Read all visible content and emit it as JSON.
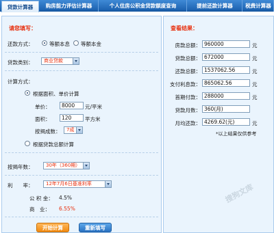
{
  "tabs": [
    "贷款计算器",
    "购房能力评估计算器",
    "个人住房公积金贷款额度查询",
    "提前还款计算器",
    "税费计算器"
  ],
  "form": {
    "title": "请您填写：",
    "repay_method_label": "还款方式：",
    "repay_options": [
      "等额本息",
      "等额本金"
    ],
    "repay_selected": "等额本息",
    "loan_type_label": "贷款类别：",
    "loan_type_value": "商业贷款",
    "calc_method_label": "计算方式：",
    "calc_option_area": "根据面积、单价计算",
    "price_label": "单价：",
    "price_value": "8000",
    "price_unit": "元/平米",
    "area_label": "面积：",
    "area_value": "120",
    "area_unit": "平方米",
    "down_ratio_label": "按揭成数：",
    "down_ratio_value": "7成",
    "calc_option_total": "根据贷款总额计算",
    "years_label": "按揭年数：",
    "years_value": "30年（360期）",
    "rate_label": "利　　率：",
    "rate_value": "12年7月6日基准利率",
    "fund_label": "公 积 金：",
    "fund_rate": "4.5%",
    "commercial_label": "商　业：",
    "commercial_rate": "6.55%",
    "start_button": "开始计算",
    "reset_button": "重新填写"
  },
  "results": {
    "title": "查看结果：",
    "rows": [
      {
        "label": "房款总额：",
        "value": "960000",
        "unit": "元"
      },
      {
        "label": "贷款总额：",
        "value": "672000",
        "unit": "元"
      },
      {
        "label": "还款总额：",
        "value": "1537062.56",
        "unit": "元"
      },
      {
        "label": "支付利息款：",
        "value": "865062.56",
        "unit": "元"
      },
      {
        "label": "首期付款：",
        "value": "288000",
        "unit": "元"
      },
      {
        "label": "贷款月数：",
        "value": "360(月)",
        "unit": ""
      },
      {
        "label": "月均还款：",
        "value": "4269.62(元)",
        "unit": "元"
      }
    ],
    "footnote": "*以上结果仅供参考"
  },
  "watermark": "搜狗文库",
  "colors": {
    "tab_bar": "#1d62b0",
    "panel_bg": "#eaf4fd",
    "accent_red": "#e8300f",
    "button_orange": "#f08a12",
    "button_blue": "#2a72c2"
  }
}
